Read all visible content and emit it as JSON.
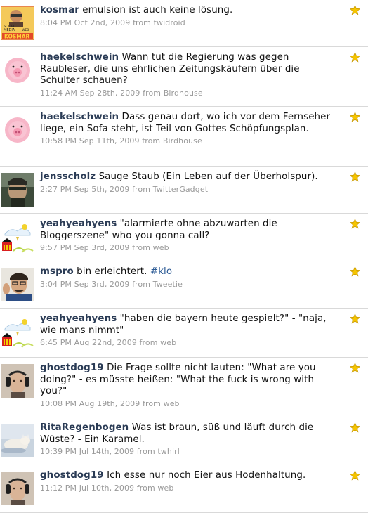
{
  "colors": {
    "username": "#2a3b55",
    "meta": "#999999",
    "star": "#f5c400",
    "divider": "#d9d9d9"
  },
  "tweets": [
    {
      "username": "kosmar",
      "text": "emulsion ist auch keine lösung.",
      "time": "8:04 PM Oct 2nd, 2009",
      "from_label": "from",
      "source": "twidroid",
      "favorite_icon": "star-icon",
      "avatar_text": [
        "SOCIAL",
        "MEDIA",
        "WEB",
        "KOSMAR"
      ]
    },
    {
      "username": "haekelschwein",
      "text": "Wann tut die Regierung was gegen Raubleser, die uns ehrlichen Zeitungskäufern über die Schulter schauen?",
      "time": "11:24 AM Sep 28th, 2009",
      "from_label": "from",
      "source": "Birdhouse",
      "favorite_icon": "star-icon"
    },
    {
      "username": "haekelschwein",
      "text": "Dass genau dort, wo ich vor dem Fernseher liege, ein Sofa steht, ist Teil von Gottes Schöpfungsplan.",
      "time": "10:58 PM Sep 11th, 2009",
      "from_label": "from",
      "source": "Birdhouse",
      "favorite_icon": "star-icon"
    },
    {
      "username": "jensscholz",
      "text": "Sauge Staub (Ein Leben auf der Überholspur).",
      "time": "2:27 PM Sep 5th, 2009",
      "from_label": "from",
      "source": "TwitterGadget",
      "favorite_icon": "star-icon"
    },
    {
      "username": "yeahyeahyens",
      "text": "\"alarmierte ohne abzuwarten die Bloggerszene\" who you gonna call?",
      "time": "9:57 PM Sep 3rd, 2009",
      "from_label": "from",
      "source": "web",
      "favorite_icon": "star-icon"
    },
    {
      "username": "mspro",
      "text": "bin erleichtert.",
      "hashtag": "#klo",
      "time": "3:04 PM Sep 3rd, 2009",
      "from_label": "from",
      "source": "Tweetie",
      "favorite_icon": "star-icon"
    },
    {
      "username": "yeahyeahyens",
      "text": "\"haben die bayern heute gespielt?\" - \"naja, wie mans nimmt\"",
      "time": "6:45 PM Aug 22nd, 2009",
      "from_label": "from",
      "source": "web",
      "favorite_icon": "star-icon"
    },
    {
      "username": "ghostdog19",
      "text": "Die Frage sollte nicht lauten: \"What are you doing?\" - es müsste heißen: \"What the fuck is wrong with you?\"",
      "time": "10:08 PM Aug 19th, 2009",
      "from_label": "from",
      "source": "web",
      "favorite_icon": "star-icon"
    },
    {
      "username": "RitaRegenbogen",
      "text": "Was ist braun, süß und läuft durch die Wüste? - Ein Karamel.",
      "time": "10:39 PM Jul 14th, 2009",
      "from_label": "from",
      "source": "twhirl",
      "favorite_icon": "star-icon"
    },
    {
      "username": "ghostdog19",
      "text": "Ich esse nur noch Eier aus Hodenhaltung.",
      "time": "11:12 PM Jul 10th, 2009",
      "from_label": "from",
      "source": "web",
      "favorite_icon": "star-icon"
    }
  ]
}
